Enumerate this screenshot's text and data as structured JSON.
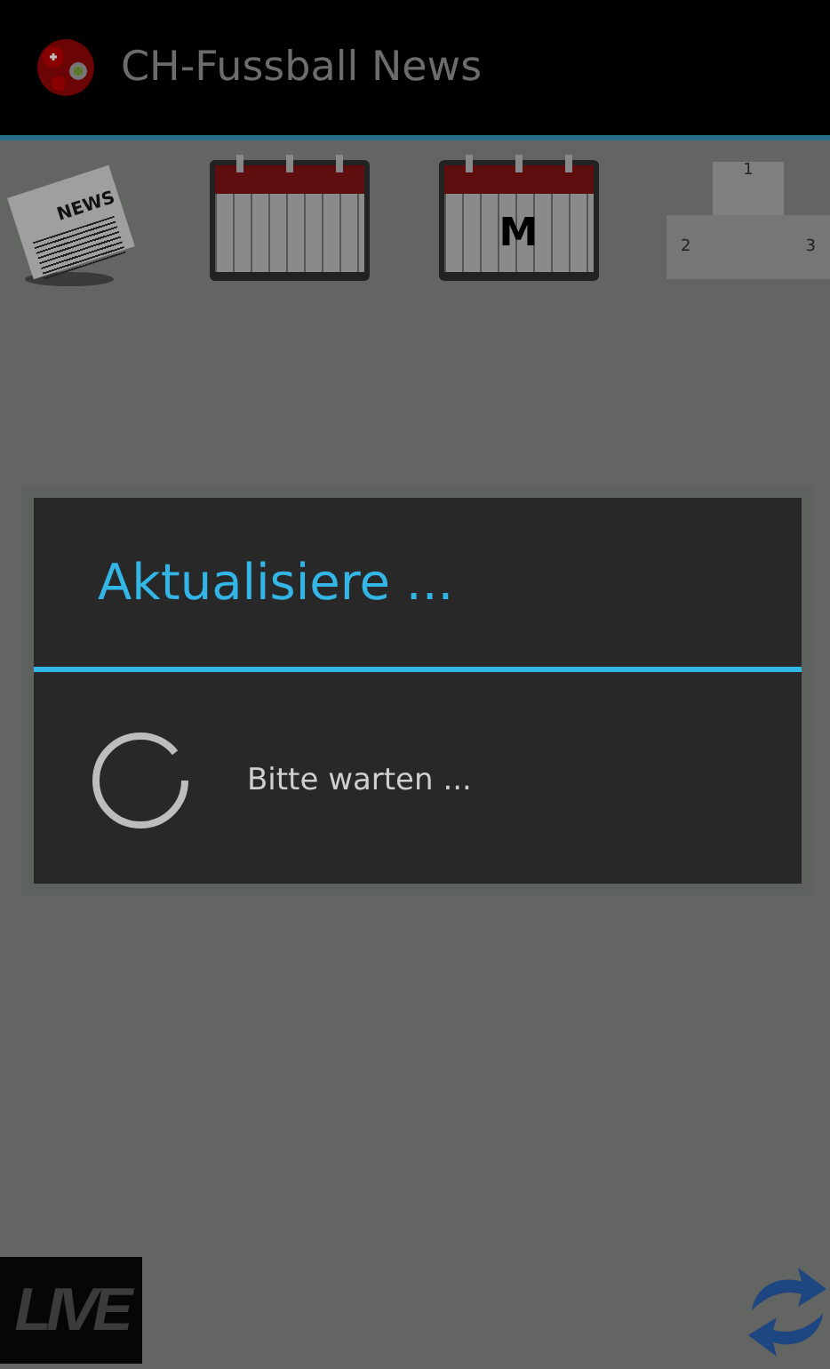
{
  "action_bar": {
    "title": "CH-Fussball News"
  },
  "nav_icons": [
    {
      "kind": "news",
      "label": "NEWS"
    },
    {
      "kind": "calendar"
    },
    {
      "kind": "calendar",
      "label": "M"
    },
    {
      "kind": "podium",
      "places": [
        "1",
        "2",
        "3"
      ]
    }
  ],
  "dialog": {
    "title": "Aktualisiere ...",
    "message": "Bitte warten ..."
  },
  "bottom": {
    "live_label": "LIVE"
  }
}
